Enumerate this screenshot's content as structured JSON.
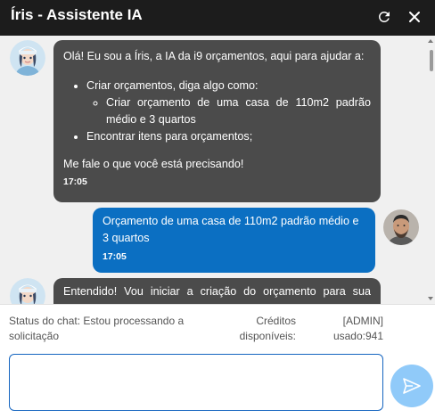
{
  "header": {
    "title": "Íris - Assistente IA",
    "refresh_icon": "refresh-icon",
    "close_icon": "close-icon"
  },
  "messages": [
    {
      "sender": "ai",
      "intro": "Olá! Eu sou a Íris, a IA da i9 orçamentos, aqui para ajudar a:",
      "list": [
        {
          "text": "Criar orçamentos, diga algo como:",
          "sub": [
            "Criar orçamento de uma casa de 110m2 padrão médio e 3 quartos"
          ]
        },
        {
          "text": "Encontrar itens para orçamentos;"
        }
      ],
      "outro": "Me fale o que você está precisando!",
      "time": "17:05"
    },
    {
      "sender": "user",
      "text": "Orçamento de uma casa de 110m2 padrão médio e 3 quartos",
      "time": "17:05"
    },
    {
      "sender": "ai",
      "text": "Entendido! Vou iniciar a criação do orçamento para sua"
    }
  ],
  "status": {
    "chat_status": "Status do chat: Estou processando a solicitação",
    "credits_label": "Créditos disponíveis:",
    "credits_value": "[ADMIN] usado:941"
  },
  "input": {
    "placeholder": "",
    "value": ""
  },
  "send_icon": "send-icon",
  "colors": {
    "header_bg": "#1c1c1c",
    "ai_bubble": "#4b4b4b",
    "user_bubble": "#0b6fc2",
    "send_button": "#90caf9",
    "input_border": "#1565c0"
  }
}
